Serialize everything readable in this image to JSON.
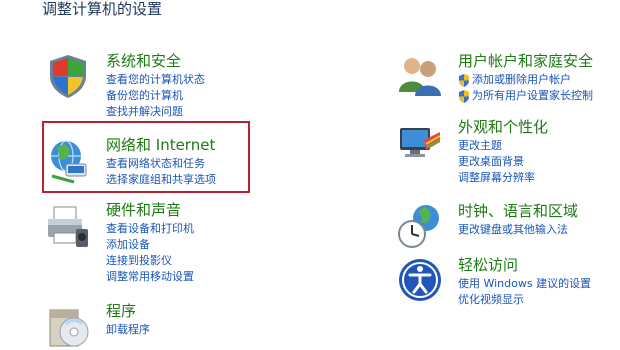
{
  "page_title": "调整计算机的设置",
  "categories": [
    {
      "title": "系统和安全",
      "links": [
        "查看您的计算机状态",
        "备份您的计算机",
        "查找并解决问题"
      ],
      "icon": "system-security-shield-icon"
    },
    {
      "title": "网络和 Internet",
      "links": [
        "查看网络状态和任务",
        "选择家庭组和共享选项"
      ],
      "icon": "network-globe-icon"
    },
    {
      "title": "硬件和声音",
      "links": [
        "查看设备和打印机",
        "添加设备",
        "连接到投影仪",
        "调整常用移动设置"
      ],
      "icon": "printer-icon"
    },
    {
      "title": "程序",
      "links": [
        "卸载程序"
      ],
      "icon": "programs-disc-icon"
    },
    {
      "title": "用户帐户和家庭安全",
      "links": [
        "添加或删除用户帐户",
        "为所有用户设置家长控制"
      ],
      "icon": "users-icon"
    },
    {
      "title": "外观和个性化",
      "links": [
        "更改主题",
        "更改桌面背景",
        "调整屏幕分辨率"
      ],
      "icon": "monitor-palette-icon"
    },
    {
      "title": "时钟、语言和区域",
      "links": [
        "更改键盘或其他输入法"
      ],
      "icon": "clock-globe-icon"
    },
    {
      "title": "轻松访问",
      "links": [
        "使用 Windows 建议的设置",
        "优化视频显示"
      ],
      "icon": "accessibility-icon"
    }
  ],
  "colors": {
    "category_title": "#1e7a14",
    "link": "#1a55b8",
    "highlight_border": "#b52232",
    "page_title": "#1e395b"
  }
}
